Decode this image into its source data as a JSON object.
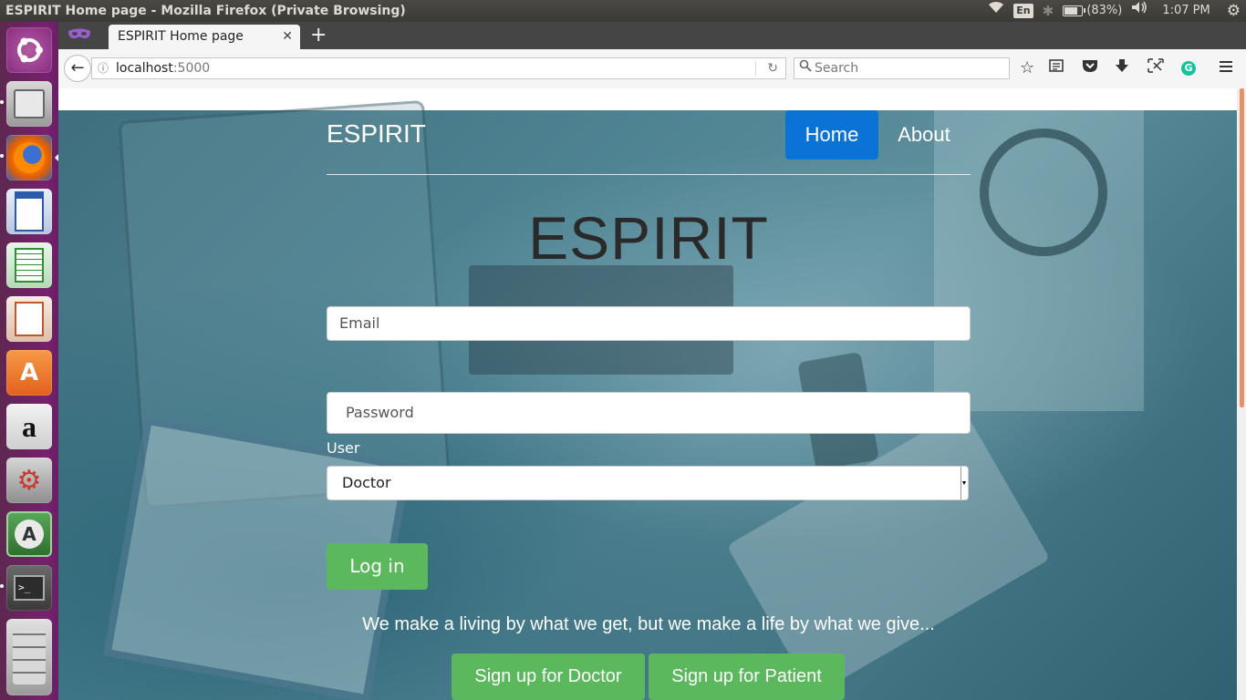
{
  "window": {
    "title": "ESPIRIT Home page - Mozilla Firefox (Private Browsing)"
  },
  "panel": {
    "lang": "En",
    "battery": "(83%)",
    "time": "1:07 PM"
  },
  "launcher": {
    "items": [
      "ubuntu-dash",
      "files",
      "firefox",
      "libreoffice-writer",
      "libreoffice-calc",
      "libreoffice-impress",
      "software-center",
      "amazon",
      "system-settings",
      "software-updater",
      "terminal",
      "workspaces"
    ]
  },
  "browser": {
    "tab_title": "ESPIRIT Home page",
    "url_host": "localhost",
    "url_port": ":5000",
    "search_placeholder": "Search"
  },
  "page": {
    "brand": "ESPIRIT",
    "nav": {
      "home": "Home",
      "about": "About"
    },
    "hero_title": "ESPIRIT",
    "email_placeholder": "Email",
    "password_placeholder": "Password",
    "user_label": "User",
    "user_selected": "Doctor",
    "login_label": "Log in",
    "quote": "We make a living by what we get, but we make a life by what we give...",
    "signup_doctor": "Sign up for Doctor",
    "signup_patient": "Sign up for Patient"
  },
  "colors": {
    "primary_nav": "#0b73d6",
    "success_button": "#5cb85c",
    "launcher_bg": "#77216f"
  }
}
